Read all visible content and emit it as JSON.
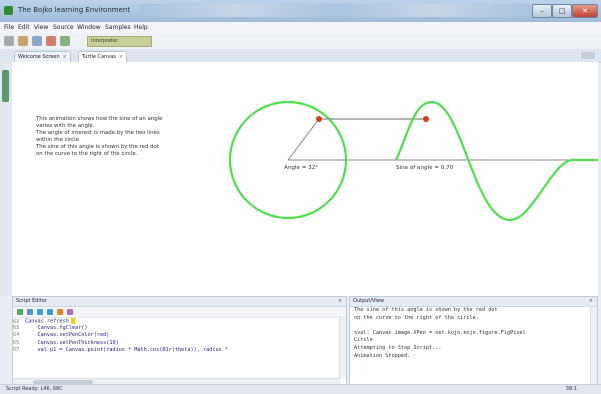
{
  "window": {
    "title": "The Bojko learning Environment"
  },
  "menu": [
    "File",
    "Edit",
    "View",
    "Source",
    "Window",
    "Samples",
    "Help"
  ],
  "toolbar": {
    "field_text": "Interpreter"
  },
  "tabs": [
    {
      "label": "Welcome Screen"
    },
    {
      "label": "Turtle Canvas"
    }
  ],
  "description": [
    "This animation shows how the sine of an angle",
    "varies with the angle.",
    "The angle of interest is made by the two lines",
    "within the circle.",
    "The sine of this angle is shown by the red dot",
    "on the curve to the right of the circle."
  ],
  "graph": {
    "angle_label": "Angle = 32°",
    "sine_label": "Sine of angle = 0.70",
    "colors": {
      "curve": "#4ee04e",
      "dot": "#d63d1e",
      "axis": "#8a8a8a"
    }
  },
  "script_editor": {
    "title": "Script Editor",
    "lines": [
      {
        "no": "62",
        "text": "Canvas.refresh"
      },
      {
        "no": "63",
        "text": "    Canvas.fgClear()"
      },
      {
        "no": "64",
        "text": "    Canvas.setPenColor(red)"
      },
      {
        "no": "65",
        "text": "    Canvas.setPenThickness(10)"
      },
      {
        "no": "67",
        "text": "    val p1 = Canvas.point(radius * Math.cos(Ø1r(theta)), radius *"
      }
    ]
  },
  "output": {
    "title": "Output/View",
    "lines": [
      "The sine of this angle is shown by the red dot",
      "on the curve to the right of the circle.",
      "",
      "sval: Canvas.image.XPen = net.kojo.kojo.figure.FigPixel",
      "Circle",
      "Attempting to Stop Script...",
      "Animation Stopped."
    ]
  },
  "status": {
    "left": "Script Ready: L46, 68C",
    "right": "38:1"
  }
}
